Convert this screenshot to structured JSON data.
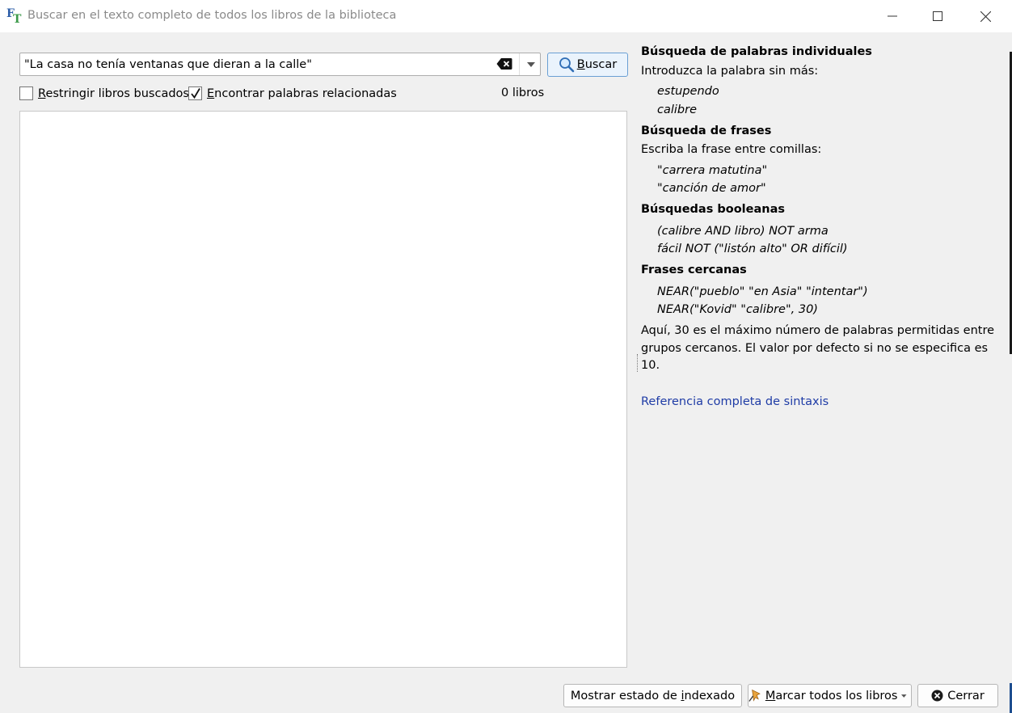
{
  "window": {
    "title": "Buscar en el texto completo de todos los libros de la biblioteca",
    "app_icon": "FT-icon",
    "controls": [
      "minimize-icon",
      "maximize-icon",
      "close-icon"
    ]
  },
  "search": {
    "value": "\"La casa no tenía ventanas que dieran a la calle\"",
    "button_prefix": "",
    "button_mnemonic": "B",
    "button_rest": "uscar"
  },
  "options": {
    "restrict_mnemonic": "R",
    "restrict_rest": "estringir libros buscados",
    "restrict_checked": false,
    "related_mnemonic": "E",
    "related_rest": "ncontrar palabras relacionadas",
    "related_checked": true,
    "count": "0 libros"
  },
  "help": {
    "single_title": "Búsqueda de palabras individuales",
    "single_intro": "Introduzca la palabra sin más:",
    "single_ex1": "estupendo",
    "single_ex2": "calibre",
    "phrase_title": "Búsqueda de frases",
    "phrase_intro": "Escriba la frase entre comillas:",
    "phrase_ex1": "\"carrera matutina\"",
    "phrase_ex2": "\"canción de amor\"",
    "bool_title": "Búsquedas booleanas",
    "bool_ex1": "(calibre AND libro) NOT arma",
    "bool_ex2": "fácil NOT (\"listón alto\" OR difícil)",
    "near_title": "Frases cercanas",
    "near_ex1": "NEAR(\"pueblo\" \"en Asia\" \"intentar\")",
    "near_ex2": "NEAR(\"Kovid\" \"calibre\", 30)",
    "near_note": "Aquí, 30 es el máximo número de palabras permitidas entre grupos cercanos. El valor por defecto si no se especifica es 10.",
    "link": "Referencia completa de sintaxis"
  },
  "footer": {
    "indexed_pre": "Mostrar estado de ",
    "indexed_mnemonic": "i",
    "indexed_post": "ndexado",
    "mark_mnemonic": "M",
    "mark_rest": "arcar todos los libros",
    "close_label": "Cerrar"
  },
  "colors": {
    "link": "#1f3ca6",
    "primary_button_border": "#6a9fd4",
    "primary_button_bg": "#eaf3fc",
    "close_icon": "#1a1a1a",
    "mark_icon": "#e8a33d"
  }
}
